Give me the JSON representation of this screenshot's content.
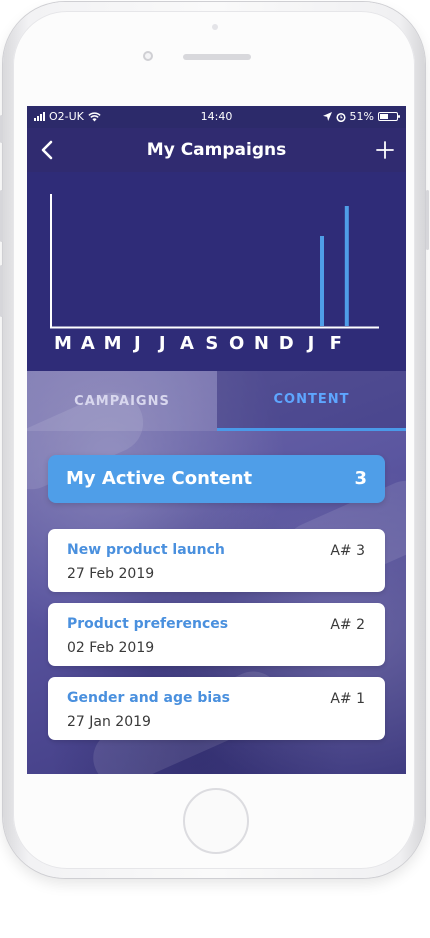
{
  "status_bar": {
    "carrier": "O2-UK",
    "time": "14:40",
    "battery": "51%",
    "battery_level": 0.51
  },
  "nav": {
    "title": "My Campaigns",
    "back_icon": "chevron-left-icon",
    "add_icon": "plus-icon"
  },
  "chart_data": {
    "type": "bar",
    "categories": [
      "M",
      "A",
      "M",
      "J",
      "J",
      "A",
      "S",
      "O",
      "N",
      "D",
      "J",
      "F"
    ],
    "values": [
      0,
      0,
      0,
      0,
      0,
      0,
      0,
      0,
      0,
      0,
      3,
      4
    ],
    "title": "",
    "xlabel": "",
    "ylabel": "",
    "ylim": [
      0,
      4.4
    ],
    "grid": false,
    "bar_color": "#4f9ee8",
    "axis_color": "#ffffff"
  },
  "tabs": [
    {
      "label": "CAMPAIGNS",
      "active": false
    },
    {
      "label": "CONTENT",
      "active": true
    }
  ],
  "active_content": {
    "label": "My Active Content",
    "count": "3"
  },
  "content_items": [
    {
      "title": "New product launch",
      "date": "27 Feb 2019",
      "id": "A# 3"
    },
    {
      "title": "Product preferences",
      "date": "02 Feb 2019",
      "id": "A# 2"
    },
    {
      "title": "Gender and age bias",
      "date": "27 Jan 2019",
      "id": "A# 1"
    }
  ],
  "colors": {
    "accent": "#4f9ee8",
    "nav_background": "#302b70",
    "chart_background": "#2f2c78",
    "active_tab_text": "#5ea6ff",
    "card_title": "#4a90de"
  }
}
